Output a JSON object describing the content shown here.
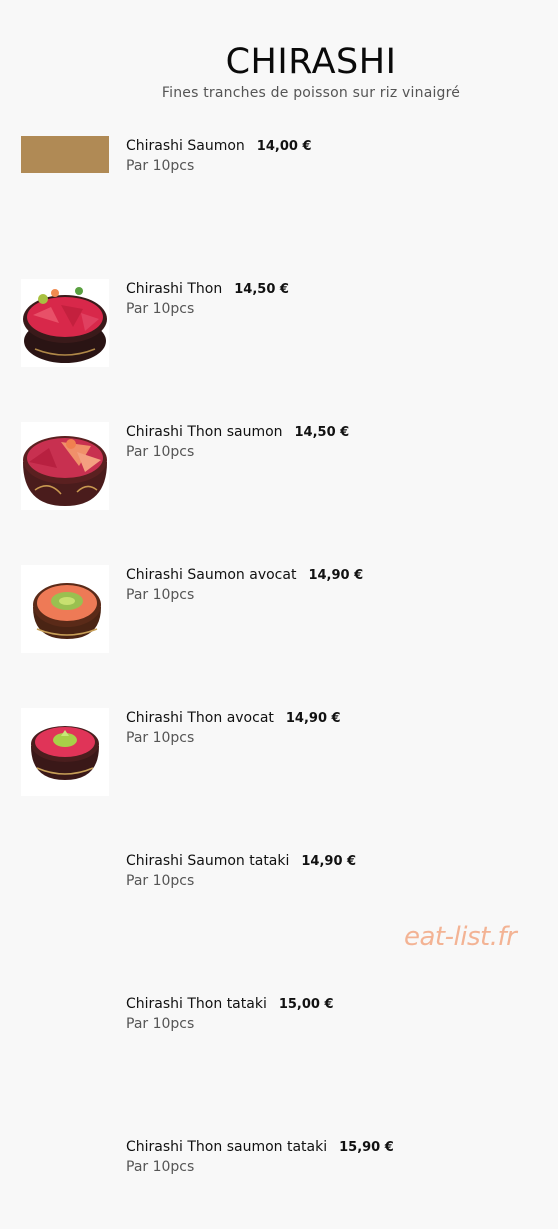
{
  "header": {
    "title": "CHIRASHI",
    "subtitle": "Fines tranches de poisson sur riz vinaigré"
  },
  "items": [
    {
      "name": "Chirashi Saumon",
      "price": "14,00 €",
      "portion": "Par 10pcs",
      "image": "bowl-salmon-icon"
    },
    {
      "name": "Chirashi Thon",
      "price": "14,50 €",
      "portion": "Par 10pcs",
      "image": "bowl-tuna-icon"
    },
    {
      "name": "Chirashi Thon saumon",
      "price": "14,50 €",
      "portion": "Par 10pcs",
      "image": "bowl-tuna-salmon-icon"
    },
    {
      "name": "Chirashi Saumon avocat",
      "price": "14,90 €",
      "portion": "Par 10pcs",
      "image": "bowl-salmon-avocado-icon"
    },
    {
      "name": "Chirashi Thon avocat",
      "price": "14,90 €",
      "portion": "Par 10pcs",
      "image": "bowl-tuna-avocado-icon"
    },
    {
      "name": "Chirashi Saumon tataki",
      "price": "14,90 €",
      "portion": "Par 10pcs"
    },
    {
      "name": "Chirashi Thon tataki",
      "price": "15,00 €",
      "portion": "Par 10pcs"
    },
    {
      "name": "Chirashi Thon saumon tataki",
      "price": "15,90 €",
      "portion": "Par 10pcs"
    }
  ],
  "watermark": "eat-list.fr",
  "colors": {
    "background": "#f8f8f8",
    "watermark": "#f3b394",
    "salmon": "#f08060",
    "tuna": "#d8284a"
  }
}
